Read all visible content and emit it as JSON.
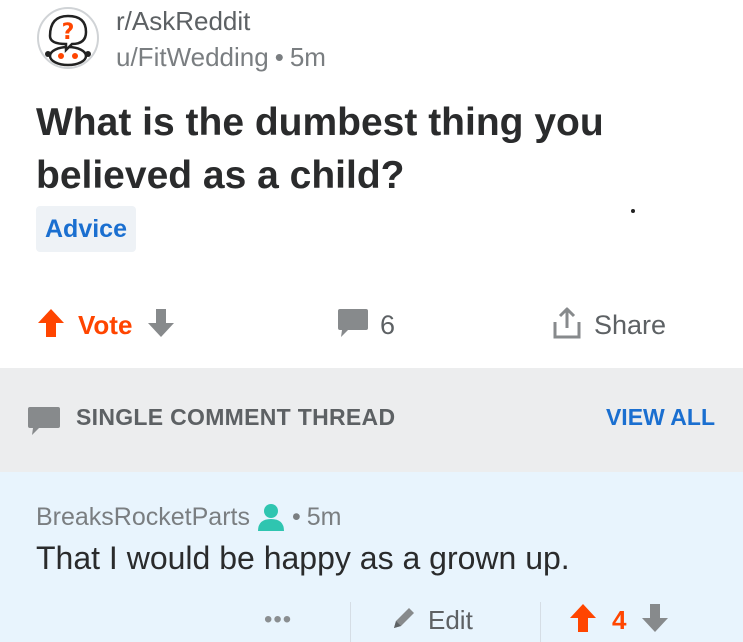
{
  "post": {
    "subreddit": "r/AskReddit",
    "author": "u/FitWedding",
    "separator": "•",
    "age": "5m",
    "title": "What is the dumbest thing you believed as a child?",
    "flair": "Advice",
    "avatar_icon": "askreddit-snoo-icon"
  },
  "actions": {
    "vote_label": "Vote",
    "upvote_icon": "upvote-arrow-icon",
    "downvote_icon": "downvote-arrow-icon",
    "comment_icon": "comment-bubble-icon",
    "comment_count": "6",
    "share_icon": "share-icon",
    "share_label": "Share"
  },
  "thread_bar": {
    "label": "SINGLE COMMENT THREAD",
    "view_all": "VIEW ALL"
  },
  "comment": {
    "author": "BreaksRocketParts",
    "separator": "•",
    "age": "5m",
    "body": "That I would be happy as a grown up.",
    "more_label": "•••",
    "edit_label": "Edit",
    "score": "4",
    "user_icon": "user-person-icon"
  },
  "colors": {
    "accent_orange": "#ff4500",
    "link_blue": "#1a6fd0",
    "thread_bar_bg": "#ecedee",
    "comment_highlight_bg": "#e8f4fd",
    "user_icon_teal": "#2fc5b0"
  }
}
